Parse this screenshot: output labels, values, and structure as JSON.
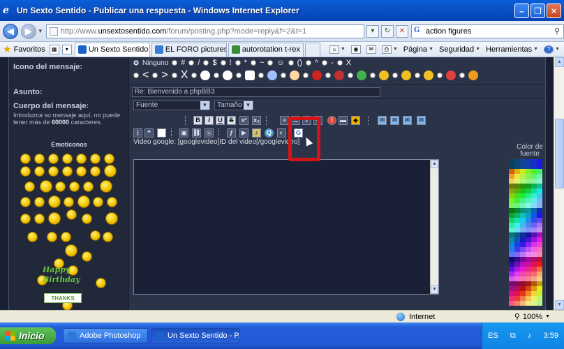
{
  "window": {
    "title": "Un Sexto Sentido - Publicar una respuesta - Windows Internet Explorer"
  },
  "address": {
    "url_prefix": "http://www.",
    "url_domain": "unsextosentido.com",
    "url_rest": "/forum/posting.php?mode=reply&f=2&t=1",
    "search_value": "action figures"
  },
  "favorites_label": "Favoritos",
  "tabs": [
    {
      "label": "Un Sexto Sentido ...",
      "color": "#1a62c9",
      "active": true
    },
    {
      "label": "EL FORO pictures by ...",
      "color": "#3b7bd8",
      "active": false
    },
    {
      "label": "autorotation t-rex",
      "color": "#3a8a3a",
      "active": false
    }
  ],
  "commandbar": {
    "page": "Página",
    "security": "Seguridad",
    "tools": "Herramientas"
  },
  "form": {
    "icon_label": "Icono del mensaje:",
    "none_option": "Ninguno",
    "subject_label": "Asunto:",
    "subject_value": "Re: Bienvenido a phpBB3",
    "body_label": "Cuerpo del mensaje:",
    "body_desc_1": "Introduzca su mensaje aquí, no puede tener más de ",
    "body_desc_limit": "60000",
    "body_desc_2": " caracteres.",
    "emoticons_label": "Emoticonos",
    "font_select": "Fuente",
    "size_select": "Tamaño",
    "help_text": "Video google: [googlevideo]ID del video[/googlevideo]",
    "color_label": "Color de fuente",
    "happy_text": "Happy Birthday",
    "thanks_text": "THANKS"
  },
  "toolbar": {
    "bold": "B",
    "italic": "I",
    "underline": "U",
    "strike": "S"
  },
  "status": {
    "zone": "Internet",
    "zoom": "100%"
  },
  "taskbar": {
    "start": "Inicio",
    "tasks": [
      {
        "label": "Adobe Photoshop",
        "color": "#2a7ad6"
      },
      {
        "label": "Un Sexto Sentido - P...",
        "color": "#1a62c9"
      }
    ],
    "lang": "ES",
    "clock": "3:59"
  },
  "colors": {
    "accent_red": "#d41414",
    "forum_bg": "#283047"
  }
}
